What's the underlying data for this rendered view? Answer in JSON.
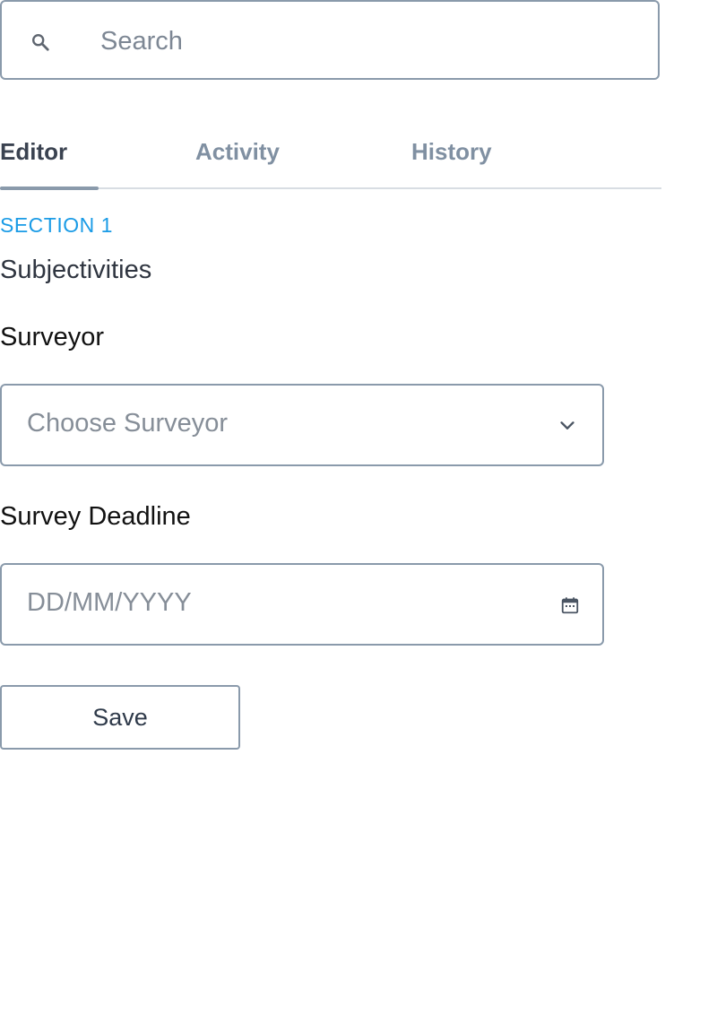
{
  "search": {
    "placeholder": "Search",
    "icon": "search-icon"
  },
  "tabs": [
    {
      "label": "Editor",
      "active": true
    },
    {
      "label": "Activity",
      "active": false
    },
    {
      "label": "History",
      "active": false
    }
  ],
  "section": {
    "label": "SECTION 1",
    "title": "Subjectivities"
  },
  "form": {
    "surveyor": {
      "label": "Surveyor",
      "placeholder": "Choose Surveyor",
      "icon": "chevron-down-icon"
    },
    "deadline": {
      "label": "Survey Deadline",
      "placeholder": "DD/MM/YYYY",
      "icon": "calendar-icon"
    },
    "save_label": "Save"
  },
  "colors": {
    "accent": "#1a9be6",
    "border": "#8a9aab",
    "active_tab": "#3a4250",
    "inactive_tab": "#8090a2"
  }
}
